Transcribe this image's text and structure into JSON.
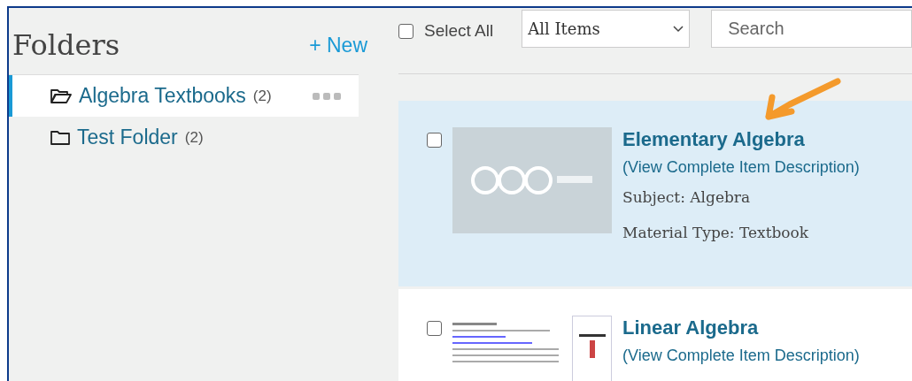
{
  "sidebar": {
    "title": "Folders",
    "new_button": "+ New",
    "folders": [
      {
        "name": "Algebra Textbooks",
        "count": "(2)",
        "selected": true
      },
      {
        "name": "Test Folder",
        "count": "(2)",
        "selected": false
      }
    ]
  },
  "toolbar": {
    "select_all": {
      "label": "Select All",
      "checked": false
    },
    "filter": {
      "value": "All Items"
    },
    "search": {
      "placeholder": "Search"
    }
  },
  "items": [
    {
      "kind": "oer",
      "title": "Elementary Algebra",
      "link": "(View Complete Item Description)",
      "subject": "Subject: Algebra",
      "material_type": "Material Type: Textbook",
      "selected": true,
      "checked": false
    },
    {
      "kind": "document",
      "title": "Linear Algebra",
      "link": "(View Complete Item Description)",
      "selected": false,
      "checked": false
    }
  ]
}
